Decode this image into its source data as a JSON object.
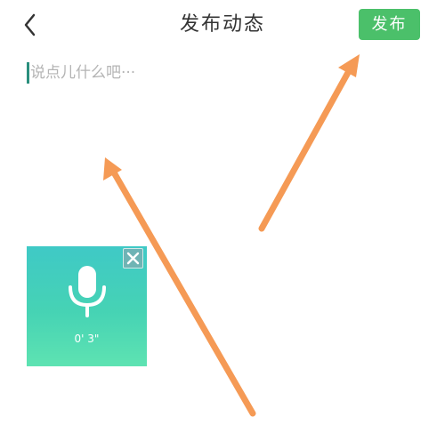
{
  "header": {
    "back_icon": "chevron-left-icon",
    "title": "发布动态",
    "publish_label": "发布"
  },
  "editor": {
    "placeholder": "说点儿什么吧···"
  },
  "voice_note": {
    "icon": "microphone-icon",
    "duration": "0' 3\"",
    "close_icon": "close-icon"
  },
  "colors": {
    "publish_button": "#4bc06a",
    "voice_card_top": "#3fc9c6",
    "voice_card_bottom": "#5ee3b2",
    "annotation_arrow": "#f59a55",
    "caret": "#2a8f7d"
  }
}
